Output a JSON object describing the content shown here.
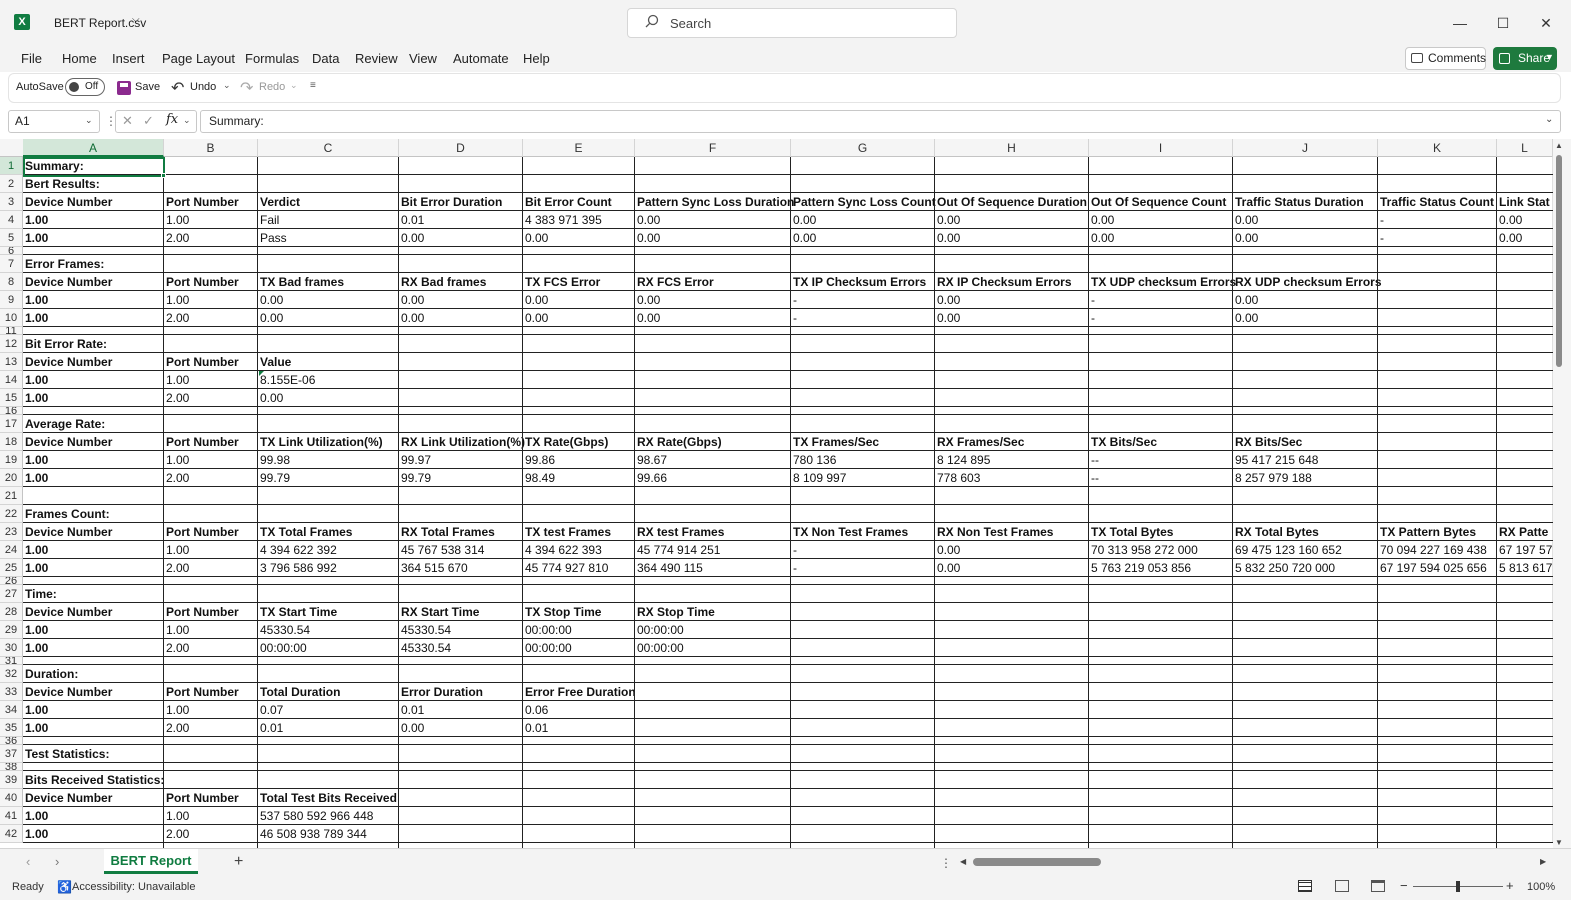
{
  "app": {
    "file_name": "BERT Report.csv",
    "search_placeholder": "Search",
    "window_controls": [
      "minimize",
      "maximize",
      "close"
    ]
  },
  "menu": {
    "items": [
      "File",
      "Home",
      "Insert",
      "Page Layout",
      "Formulas",
      "Data",
      "Review",
      "View",
      "Automate",
      "Help"
    ],
    "comments_label": "Comments",
    "share_label": "Share"
  },
  "qat": {
    "autosave_label": "AutoSave",
    "autosave_state": "Off",
    "save_label": "Save",
    "undo_label": "Undo",
    "redo_label": "Redo"
  },
  "formula_bar": {
    "name_box": "A1",
    "fx_label": "fx",
    "value": "Summary:"
  },
  "grid": {
    "selected_cell": "A1",
    "columns": [
      "A",
      "B",
      "C",
      "D",
      "E",
      "F",
      "G",
      "H",
      "I",
      "J",
      "K",
      "L"
    ],
    "rows": [
      {
        "n": "1",
        "cells": [
          {
            "t": "Summary:",
            "b": true
          }
        ]
      },
      {
        "n": "2",
        "cells": [
          {
            "t": "Bert Results:",
            "b": true
          }
        ]
      },
      {
        "n": "3",
        "cells": [
          {
            "t": "Device Number",
            "b": true
          },
          {
            "t": "Port Number",
            "b": true
          },
          {
            "t": "Verdict",
            "b": true
          },
          {
            "t": "Bit Error Duration",
            "b": true
          },
          {
            "t": "Bit Error Count",
            "b": true
          },
          {
            "t": "Pattern Sync Loss Duration",
            "b": true
          },
          {
            "t": "Pattern Sync Loss Count",
            "b": true
          },
          {
            "t": "Out Of Sequence Duration",
            "b": true
          },
          {
            "t": "Out Of Sequence Count",
            "b": true
          },
          {
            "t": "Traffic Status Duration",
            "b": true
          },
          {
            "t": "Traffic Status Count",
            "b": true
          },
          {
            "t": "Link Stat",
            "b": true
          }
        ]
      },
      {
        "n": "4",
        "cells": [
          {
            "t": "1.00",
            "b": true
          },
          {
            "t": "1.00"
          },
          {
            "t": "Fail"
          },
          {
            "t": "0.01"
          },
          {
            "t": "4 383 971 395"
          },
          {
            "t": "0.00"
          },
          {
            "t": "0.00"
          },
          {
            "t": "0.00"
          },
          {
            "t": "0.00"
          },
          {
            "t": "0.00"
          },
          {
            "t": "-"
          },
          {
            "t": "0.00"
          }
        ]
      },
      {
        "n": "5",
        "cells": [
          {
            "t": "1.00",
            "b": true
          },
          {
            "t": "2.00"
          },
          {
            "t": "Pass"
          },
          {
            "t": "0.00"
          },
          {
            "t": "0.00"
          },
          {
            "t": "0.00"
          },
          {
            "t": "0.00"
          },
          {
            "t": "0.00"
          },
          {
            "t": "0.00"
          },
          {
            "t": "0.00"
          },
          {
            "t": "-"
          },
          {
            "t": "0.00"
          }
        ]
      },
      {
        "n": "6",
        "cells": [],
        "h": 8
      },
      {
        "n": "7",
        "cells": [
          {
            "t": "Error Frames:",
            "b": true
          }
        ]
      },
      {
        "n": "8",
        "cells": [
          {
            "t": "Device Number",
            "b": true
          },
          {
            "t": "Port Number",
            "b": true
          },
          {
            "t": "TX Bad frames",
            "b": true
          },
          {
            "t": "RX Bad frames",
            "b": true
          },
          {
            "t": "TX FCS Error",
            "b": true
          },
          {
            "t": "RX FCS Error",
            "b": true
          },
          {
            "t": "TX IP Checksum Errors",
            "b": true
          },
          {
            "t": "RX IP Checksum Errors",
            "b": true
          },
          {
            "t": "TX UDP checksum Errors",
            "b": true
          },
          {
            "t": "RX UDP checksum Errors",
            "b": true
          }
        ]
      },
      {
        "n": "9",
        "cells": [
          {
            "t": "1.00",
            "b": true
          },
          {
            "t": "1.00"
          },
          {
            "t": "0.00"
          },
          {
            "t": "0.00"
          },
          {
            "t": "0.00"
          },
          {
            "t": "0.00"
          },
          {
            "t": "-"
          },
          {
            "t": "0.00"
          },
          {
            "t": "-"
          },
          {
            "t": "0.00"
          }
        ]
      },
      {
        "n": "10",
        "cells": [
          {
            "t": "1.00",
            "b": true
          },
          {
            "t": "2.00"
          },
          {
            "t": "0.00"
          },
          {
            "t": "0.00"
          },
          {
            "t": "0.00"
          },
          {
            "t": "0.00"
          },
          {
            "t": "-"
          },
          {
            "t": "0.00"
          },
          {
            "t": "-"
          },
          {
            "t": "0.00"
          }
        ]
      },
      {
        "n": "11",
        "cells": [],
        "h": 8
      },
      {
        "n": "12",
        "cells": [
          {
            "t": "Bit Error Rate:",
            "b": true
          }
        ]
      },
      {
        "n": "13",
        "cells": [
          {
            "t": "Device Number",
            "b": true
          },
          {
            "t": "Port Number",
            "b": true
          },
          {
            "t": "Value",
            "b": true
          }
        ]
      },
      {
        "n": "14",
        "cells": [
          {
            "t": "1.00",
            "b": true
          },
          {
            "t": "1.00"
          },
          {
            "t": "8.155E-06"
          }
        ]
      },
      {
        "n": "15",
        "cells": [
          {
            "t": "1.00",
            "b": true
          },
          {
            "t": "2.00"
          },
          {
            "t": "0.00"
          }
        ]
      },
      {
        "n": "16",
        "cells": [],
        "h": 8
      },
      {
        "n": "17",
        "cells": [
          {
            "t": "Average Rate:",
            "b": true
          }
        ]
      },
      {
        "n": "18",
        "cells": [
          {
            "t": "Device Number",
            "b": true
          },
          {
            "t": "Port Number",
            "b": true
          },
          {
            "t": "TX Link Utilization(%)",
            "b": true
          },
          {
            "t": "RX Link Utilization(%)",
            "b": true
          },
          {
            "t": "TX Rate(Gbps)",
            "b": true
          },
          {
            "t": "RX Rate(Gbps)",
            "b": true
          },
          {
            "t": "TX Frames/Sec",
            "b": true
          },
          {
            "t": "RX Frames/Sec",
            "b": true
          },
          {
            "t": "TX Bits/Sec",
            "b": true
          },
          {
            "t": "RX Bits/Sec",
            "b": true
          }
        ]
      },
      {
        "n": "19",
        "cells": [
          {
            "t": "1.00",
            "b": true
          },
          {
            "t": "1.00"
          },
          {
            "t": "99.98"
          },
          {
            "t": "99.97"
          },
          {
            "t": "99.86"
          },
          {
            "t": "98.67"
          },
          {
            "t": "780 136"
          },
          {
            "t": "8 124 895"
          },
          {
            "t": "--"
          },
          {
            "t": "95 417 215 648"
          }
        ]
      },
      {
        "n": "20",
        "cells": [
          {
            "t": "1.00",
            "b": true
          },
          {
            "t": "2.00"
          },
          {
            "t": "99.79"
          },
          {
            "t": "99.79"
          },
          {
            "t": "98.49"
          },
          {
            "t": "99.66"
          },
          {
            "t": "8 109 997"
          },
          {
            "t": "778 603"
          },
          {
            "t": "--"
          },
          {
            "t": "8 257 979 188"
          }
        ]
      },
      {
        "n": "21",
        "cells": []
      },
      {
        "n": "22",
        "cells": [
          {
            "t": "Frames Count:",
            "b": true
          }
        ]
      },
      {
        "n": "23",
        "cells": [
          {
            "t": "Device Number",
            "b": true
          },
          {
            "t": "Port Number",
            "b": true
          },
          {
            "t": "TX Total Frames",
            "b": true
          },
          {
            "t": " RX Total Frames",
            "b": true
          },
          {
            "t": "TX test Frames",
            "b": true
          },
          {
            "t": "RX test Frames",
            "b": true
          },
          {
            "t": "TX Non Test Frames",
            "b": true
          },
          {
            "t": "RX Non Test Frames",
            "b": true
          },
          {
            "t": "TX Total Bytes",
            "b": true
          },
          {
            "t": "RX Total Bytes",
            "b": true
          },
          {
            "t": "TX Pattern Bytes",
            "b": true
          },
          {
            "t": "RX Patte",
            "b": true
          }
        ]
      },
      {
        "n": "24",
        "cells": [
          {
            "t": "1.00",
            "b": true
          },
          {
            "t": "1.00"
          },
          {
            "t": "4 394 622 392"
          },
          {
            "t": "45 767 538 314"
          },
          {
            "t": "4 394 622 393"
          },
          {
            "t": "45 774 914 251"
          },
          {
            "t": "-"
          },
          {
            "t": "0.00"
          },
          {
            "t": "70 313 958 272 000"
          },
          {
            "t": "69 475 123 160 652"
          },
          {
            "t": "70 094 227 169 438"
          },
          {
            "t": "67 197 57"
          }
        ]
      },
      {
        "n": "25",
        "cells": [
          {
            "t": "1.00",
            "b": true
          },
          {
            "t": "2.00"
          },
          {
            "t": "3 796 586 992"
          },
          {
            "t": "364 515 670"
          },
          {
            "t": "45 774 927 810"
          },
          {
            "t": "364 490 115"
          },
          {
            "t": "-"
          },
          {
            "t": "0.00"
          },
          {
            "t": "5 763 219 053 856"
          },
          {
            "t": "5 832 250 720 000"
          },
          {
            "t": "67 197 594 025 656"
          },
          {
            "t": "5 813 617"
          }
        ]
      },
      {
        "n": "26",
        "cells": [],
        "h": 8
      },
      {
        "n": "27",
        "cells": [
          {
            "t": "Time:",
            "b": true
          }
        ]
      },
      {
        "n": "28",
        "cells": [
          {
            "t": "Device Number",
            "b": true
          },
          {
            "t": "Port Number",
            "b": true
          },
          {
            "t": "TX Start Time",
            "b": true
          },
          {
            "t": "RX Start Time",
            "b": true
          },
          {
            "t": "TX Stop Time",
            "b": true
          },
          {
            "t": "RX Stop Time",
            "b": true
          }
        ]
      },
      {
        "n": "29",
        "cells": [
          {
            "t": "1.00",
            "b": true
          },
          {
            "t": "1.00"
          },
          {
            "t": "45330.54"
          },
          {
            "t": "45330.54"
          },
          {
            "t": " 00:00:00"
          },
          {
            "t": " 00:00:00"
          }
        ]
      },
      {
        "n": "30",
        "cells": [
          {
            "t": "1.00",
            "b": true
          },
          {
            "t": "2.00"
          },
          {
            "t": " 00:00:00"
          },
          {
            "t": "45330.54"
          },
          {
            "t": " 00:00:00"
          },
          {
            "t": " 00:00:00"
          }
        ]
      },
      {
        "n": "31",
        "cells": [],
        "h": 8
      },
      {
        "n": "32",
        "cells": [
          {
            "t": "Duration:",
            "b": true
          }
        ]
      },
      {
        "n": "33",
        "cells": [
          {
            "t": "Device Number",
            "b": true
          },
          {
            "t": "Port Number",
            "b": true
          },
          {
            "t": "Total Duration",
            "b": true
          },
          {
            "t": "Error Duration",
            "b": true
          },
          {
            "t": "Error Free Duration",
            "b": true
          }
        ]
      },
      {
        "n": "34",
        "cells": [
          {
            "t": "1.00",
            "b": true
          },
          {
            "t": "1.00"
          },
          {
            "t": "0.07"
          },
          {
            "t": "0.01"
          },
          {
            "t": "0.06"
          }
        ]
      },
      {
        "n": "35",
        "cells": [
          {
            "t": "1.00",
            "b": true
          },
          {
            "t": "2.00"
          },
          {
            "t": "0.01"
          },
          {
            "t": "0.00"
          },
          {
            "t": "0.01"
          }
        ]
      },
      {
        "n": "36",
        "cells": [],
        "h": 8
      },
      {
        "n": "37",
        "cells": [
          {
            "t": "Test Statistics:",
            "b": true
          }
        ]
      },
      {
        "n": "38",
        "cells": [],
        "h": 8
      },
      {
        "n": "39",
        "cells": [
          {
            "t": "Bits Received Statistics:",
            "b": true
          }
        ]
      },
      {
        "n": "40",
        "cells": [
          {
            "t": "Device Number",
            "b": true
          },
          {
            "t": "Port Number",
            "b": true
          },
          {
            "t": "Total Test Bits Received",
            "b": true
          }
        ]
      },
      {
        "n": "41",
        "cells": [
          {
            "t": "1.00",
            "b": true
          },
          {
            "t": "1.00"
          },
          {
            "t": "537 580 592 966 448"
          }
        ]
      },
      {
        "n": "42",
        "cells": [
          {
            "t": "1.00",
            "b": true
          },
          {
            "t": "2.00"
          },
          {
            "t": "46 508 938 789 344"
          }
        ]
      }
    ]
  },
  "sheet_tabs": {
    "active": "BERT Report"
  },
  "status": {
    "ready": "Ready",
    "accessibility": "Accessibility: Unavailable",
    "zoom": "100%"
  },
  "colors": {
    "accent": "#107c41",
    "share_button": "#1e7a3e",
    "chrome_bg": "#f3f3f3"
  }
}
